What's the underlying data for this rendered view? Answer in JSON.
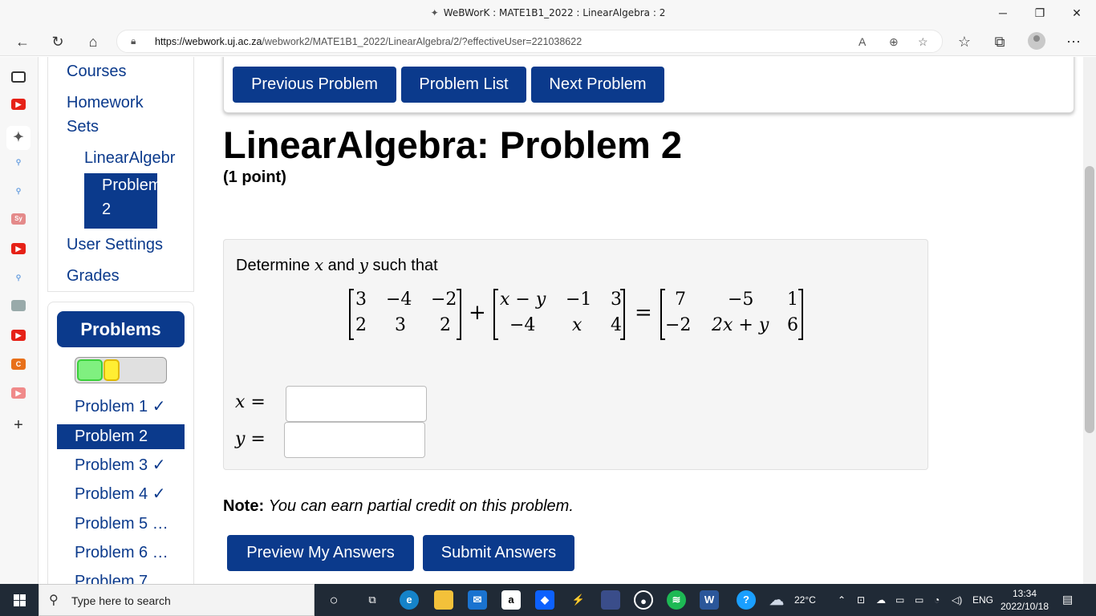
{
  "browser": {
    "window_title": "WeBWorK : MATE1B1_2022 : LinearAlgebra : 2",
    "url_domain": "https://webwork.uj.ac.za",
    "url_path": "/webwork2/MATE1B1_2022/LinearAlgebra/2/?effectiveUser=221038622"
  },
  "sidebar": {
    "links": {
      "courses": "Courses",
      "homework_line1": "Homework",
      "homework_line2": "Sets",
      "set": "LinearAlgebr",
      "problem_line1": "Problem",
      "problem_line2": "2",
      "user_settings": "User Settings",
      "grades": "Grades"
    },
    "problems_heading": "Problems",
    "problem_list": [
      {
        "label": "Problem 1 ✓"
      },
      {
        "label": "Problem 2"
      },
      {
        "label": "Problem 3 ✓"
      },
      {
        "label": "Problem 4 ✓"
      },
      {
        "label": "Problem 5 …"
      },
      {
        "label": "Problem 6 …"
      },
      {
        "label": "Problem 7"
      }
    ]
  },
  "nav_buttons": {
    "previous": "Previous Problem",
    "list": "Problem List",
    "next": "Next Problem"
  },
  "problem": {
    "title": "LinearAlgebra: Problem 2",
    "points": "(1 point)",
    "stmt_pre": "Determine",
    "stmt_x": "x",
    "stmt_and": "and",
    "stmt_y": "y",
    "stmt_post": "such that",
    "matrix_a": [
      "3",
      "−4",
      "−2",
      "2",
      "3",
      "2"
    ],
    "matrix_b": [
      "x − y",
      "−1",
      "3",
      "−4",
      "x",
      "4"
    ],
    "matrix_c": [
      "7",
      "−5",
      "1",
      "−2",
      "2x + y",
      "6"
    ],
    "plus": "+",
    "equals": "=",
    "answer_x_label": "x =",
    "answer_y_label": "y =",
    "answer_x_value": "",
    "answer_y_value": ""
  },
  "note": {
    "label": "Note:",
    "text": "You can earn partial credit on this problem."
  },
  "actions": {
    "preview": "Preview My Answers",
    "submit": "Submit Answers"
  },
  "taskbar": {
    "search_placeholder": "Type here to search",
    "weather": "22°C",
    "lang": "ENG",
    "time": "13:34",
    "date": "2022/10/18"
  }
}
